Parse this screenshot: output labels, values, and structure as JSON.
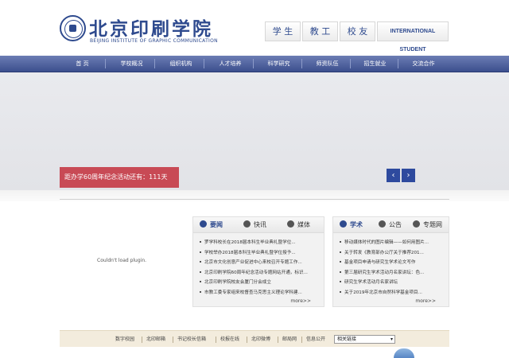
{
  "header": {
    "logo_cn": "北京印刷学院",
    "logo_en": "BEIJING INSTITUTE OF GRAPHIC COMMUNICATION",
    "quick_links": [
      "学 生",
      "教 工",
      "校 友",
      "INTERNATIONAL STUDENT"
    ]
  },
  "nav": [
    "首 页",
    "学校概况",
    "组织机构",
    "人才培养",
    "科学研究",
    "师资队伍",
    "招生就业",
    "交流合作"
  ],
  "banner": {
    "countdown": "距办学60周年纪念活动还有：111天",
    "prev": "‹",
    "next": "›"
  },
  "plugin_message": "Couldn't load plugin.",
  "news_panel": {
    "tabs": [
      "要闻",
      "快讯",
      "媒体"
    ],
    "items": [
      "罗学科校长在2018届本科生毕业典礼暨学位...",
      "学校举办2018届本科生毕业典礼暨学位授予...",
      "北京市文化创意产业促进中心来校召开专题工作...",
      "北京印刷学院60周年纪念活动专题网站开通，标识...",
      "北京印刷学院校友会厦门分会成立",
      "市教工委专家组来校督查马克思主义理论学科建..."
    ],
    "more": "more>>"
  },
  "academic_panel": {
    "tabs": [
      "学术",
      "公告",
      "专题网"
    ],
    "items": [
      "移动媒体时代的图片编辑——如何用图片...",
      "关于转发《教育部办公厅关于推荐201...",
      "基金项目申请与研究生学术论文写作",
      "第三届研究生学术活动月名家讲坛：色...",
      "研究生学术活动月名家讲坛",
      "关于2019年北京市自然科学基金项目..."
    ],
    "more": "more>>"
  },
  "footer": {
    "links": [
      "数字校园",
      "北印邮箱",
      "书记校长信箱",
      "校报在线",
      "北印微博",
      "邮局网",
      "信息公开"
    ],
    "select_value": "相关链接"
  }
}
